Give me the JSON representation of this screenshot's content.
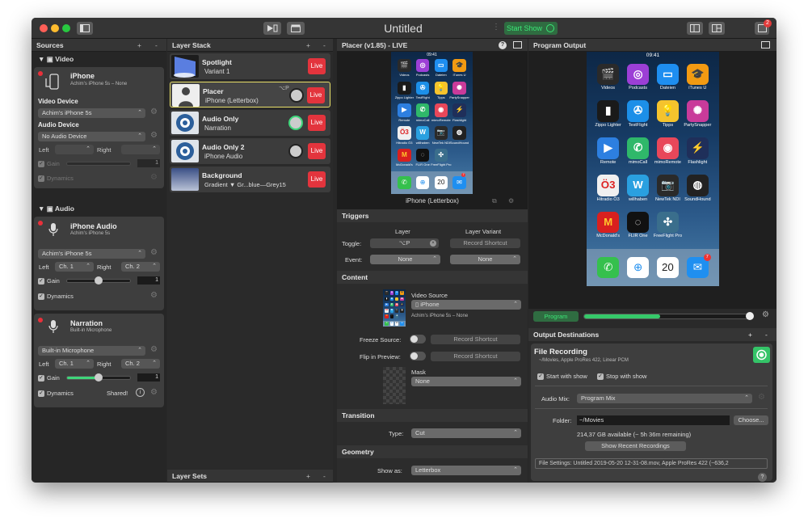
{
  "window": {
    "title": "Untitled",
    "start_show": "Start Show",
    "badge": "2"
  },
  "sources": {
    "header": "Sources",
    "plus": "+",
    "minus": "-",
    "video_group": "Video",
    "iphone": {
      "name": "iPhone",
      "sub": "Achim's iPhone 5s – None",
      "video_device_label": "Video Device",
      "video_device": "Achim's iPhone 5s",
      "audio_device_label": "Audio Device",
      "audio_device": "No Audio Device",
      "left": "Left",
      "right": "Right",
      "gain": "Gain",
      "gain_val": "1",
      "dynamics": "Dynamics"
    },
    "audio_group": "Audio",
    "iphone_audio": {
      "name": "iPhone Audio",
      "sub": "Achim's iPhone 5s",
      "device": "Achim's iPhone 5s",
      "left": "Left",
      "left_ch": "Ch. 1",
      "right": "Right",
      "right_ch": "Ch. 2",
      "gain": "Gain",
      "gain_val": "1",
      "dynamics": "Dynamics"
    },
    "narration": {
      "name": "Narration",
      "sub": "Built-in Microphone",
      "device": "Built-in Microphone",
      "left": "Left",
      "left_ch": "Ch. 1",
      "right": "Right",
      "right_ch": "Ch. 2",
      "gain": "Gain",
      "gain_val": "1",
      "dynamics": "Dynamics",
      "shared": "Shared!"
    }
  },
  "layers": {
    "header": "Layer Stack",
    "plus": "+",
    "minus": "-",
    "live": "Live",
    "items": [
      {
        "name": "Spotlight",
        "sub": "Variant 1"
      },
      {
        "name": "Placer",
        "sub": "iPhone (Letterbox)",
        "shortcut": "⌥P"
      },
      {
        "name": "Audio Only",
        "sub": "Narration"
      },
      {
        "name": "Audio Only 2",
        "sub": "iPhone Audio"
      },
      {
        "name": "Background",
        "sub": "Gradient ▼ Gr...blue—Grey15"
      }
    ],
    "sets": "Layer Sets"
  },
  "placer": {
    "header": "Placer (v1.85) - LIVE",
    "preview_label": "iPhone (Letterbox)",
    "triggers": "Triggers",
    "layer_col": "Layer",
    "variant_col": "Layer Variant",
    "toggle": "Toggle:",
    "toggle_val": "⌥P",
    "record_shortcut": "Record Shortcut",
    "event": "Event:",
    "none": "None",
    "content": "Content",
    "video_source": "Video Source",
    "video_source_val": "iPhone",
    "video_source_sub": "Achim's iPhone 5s – None",
    "freeze": "Freeze Source:",
    "flip": "Flip in Preview:",
    "mask": "Mask",
    "mask_val": "None",
    "transition": "Transition",
    "type": "Type:",
    "type_val": "Cut",
    "geometry": "Geometry",
    "show_as": "Show as:",
    "show_as_val": "Letterbox"
  },
  "program": {
    "header": "Program Output",
    "program_btn": "Program",
    "destinations": "Output Destinations",
    "plus": "+",
    "minus": "-",
    "file_recording": "File Recording",
    "file_sub": "~/Movies, Apple ProRes 422, Linear PCM",
    "start_with_show": "Start with show",
    "stop_with_show": "Stop with show",
    "audio_mix": "Audio Mix:",
    "audio_mix_val": "Program Mix",
    "folder": "Folder:",
    "folder_val": "~/Movies",
    "choose": "Choose...",
    "available": "214,37 GB available (~ 5h 36m remaining)",
    "show_recent": "Show Recent Recordings",
    "file_settings": "File Settings: Untitled 2019-05-20 12-31-08.mov, Apple ProRes 422 (~636,2",
    "help": "?"
  },
  "phone": {
    "time": "09:41",
    "apps": [
      {
        "label": "Videos",
        "color": "#2a2a2a",
        "icon": "clapper"
      },
      {
        "label": "Podcasts",
        "color": "#9c3fd6",
        "icon": "podcast"
      },
      {
        "label": "Dateien",
        "color": "#1e8ef0",
        "icon": "folder"
      },
      {
        "label": "iTunes U",
        "color": "#f29a12",
        "icon": "grad"
      },
      {
        "label": "Zippo Lighter",
        "color": "#1a1a1a",
        "icon": "zippo"
      },
      {
        "label": "TestFlight",
        "color": "#1c8fe8",
        "icon": "prop"
      },
      {
        "label": "Tipps",
        "color": "#f5c32d",
        "icon": "bulb"
      },
      {
        "label": "PartySnapper",
        "color": "#c93b9a",
        "icon": "party"
      },
      {
        "label": "Remote",
        "color": "#2d7fe0",
        "icon": "play"
      },
      {
        "label": "mimoCall",
        "color": "#2fb86a",
        "icon": "call"
      },
      {
        "label": "mimoRemote",
        "color": "#e8475a",
        "icon": "remote"
      },
      {
        "label": "Flashlight",
        "color": "#1f2f5a",
        "icon": "flash"
      },
      {
        "label": "Hitradio Ö3",
        "color": "#f0f0f0",
        "icon": "o3"
      },
      {
        "label": "willhaben",
        "color": "#2aa0e0",
        "icon": "will"
      },
      {
        "label": "NewTek NDI",
        "color": "#2a2a2a",
        "icon": "cam"
      },
      {
        "label": "SoundHound",
        "color": "#222",
        "icon": "hound"
      },
      {
        "label": "McDonald's",
        "color": "#d8201f",
        "icon": "mcd"
      },
      {
        "label": "FLIR One",
        "color": "#111",
        "icon": "flir"
      },
      {
        "label": "FreeFlight Pro",
        "color": "#3a6e8c",
        "icon": "drone"
      }
    ],
    "dock": [
      {
        "label": "",
        "color": "#35c04d",
        "icon": "phone"
      },
      {
        "label": "",
        "color": "#ffffff",
        "icon": "safari"
      },
      {
        "label": "Montag 20",
        "color": "#ffffff",
        "icon": "cal"
      },
      {
        "label": "",
        "color": "#1f8ff0",
        "icon": "mail"
      }
    ],
    "cal_day": "Montag",
    "cal_num": "20",
    "mail_badge": "7"
  },
  "colors": {
    "accent_green": "#36c96a",
    "live_red": "#e3343d",
    "selection_yellow": "#e9e069"
  }
}
